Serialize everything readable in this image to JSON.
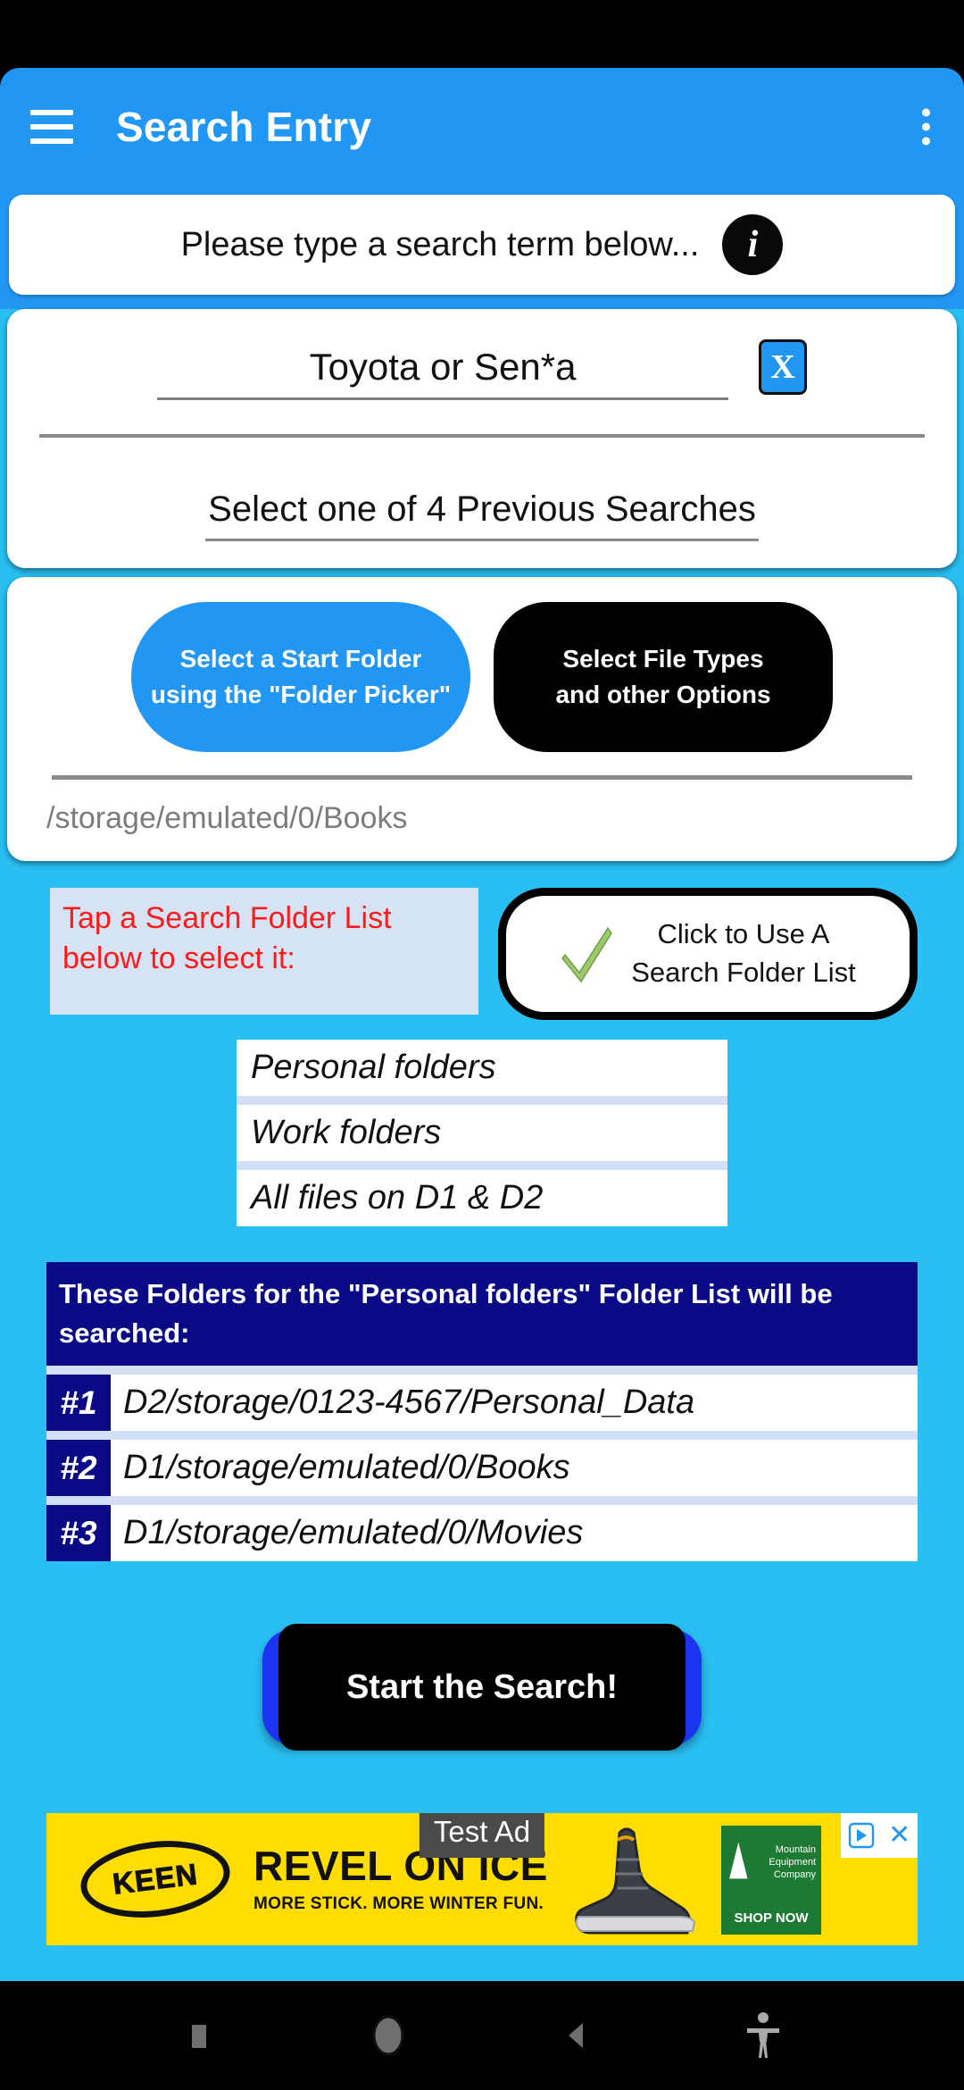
{
  "appbar": {
    "title": "Search Entry",
    "menu_icon": "hamburger-menu-icon",
    "overflow_icon": "kebab-menu-icon"
  },
  "banner": {
    "message": "Please type a search term below...",
    "info_icon": "info-icon",
    "info_glyph": "i"
  },
  "search": {
    "term_value": "Toyota or Sen*a",
    "clear_label": "X",
    "previous_searches_label": "Select one of 4 Previous Searches"
  },
  "options": {
    "start_folder_line1": "Select a Start Folder",
    "start_folder_line2": "using the \"Folder Picker\"",
    "file_types_line1": "Select File Types",
    "file_types_line2": "and other Options",
    "current_path": "/storage/emulated/0/Books"
  },
  "folder_list_selector": {
    "hint_line1": "Tap a Search Folder List",
    "hint_line2": "below to select it:",
    "use_button_line1": "Click to Use A",
    "use_button_line2": "Search Folder List",
    "check_icon": "green-check-icon",
    "lists": [
      "Personal folders",
      "Work folders",
      "All files on D1 & D2"
    ]
  },
  "searched_folders": {
    "header_line1": "These Folders for the \"Personal folders\" Folder List will be",
    "header_line2": "searched:",
    "rows": [
      {
        "num": "#1",
        "path": "D2/storage/0123-4567/Personal_Data"
      },
      {
        "num": "#2",
        "path": "D1/storage/emulated/0/Books"
      },
      {
        "num": "#3",
        "path": "D1/storage/emulated/0/Movies"
      }
    ]
  },
  "start_button": {
    "label": "Start the Search!"
  },
  "ad": {
    "overlay_label": "Test Ad",
    "brand": "KEEN",
    "headline": "REVEL ON ICE",
    "subline": "MORE STICK. MORE WINTER FUN.",
    "advertiser_line1": "Mountain",
    "advertiser_line2": "Equipment",
    "advertiser_line3": "Company",
    "cta": "SHOP NOW",
    "close_label": "✕",
    "adchoices_icon": "adchoices-icon",
    "boot_icon": "winter-boot-image"
  },
  "navbar": {
    "recents_icon": "recents-square-icon",
    "home_icon": "home-circle-icon",
    "back_icon": "back-triangle-icon",
    "accessibility_icon": "accessibility-icon"
  },
  "colors": {
    "accent_blue": "#2196F3",
    "page_blue": "#29BFF2",
    "navy": "#0A0A87",
    "alert_red": "#FF1A1A",
    "ad_yellow": "#FFDD00"
  }
}
